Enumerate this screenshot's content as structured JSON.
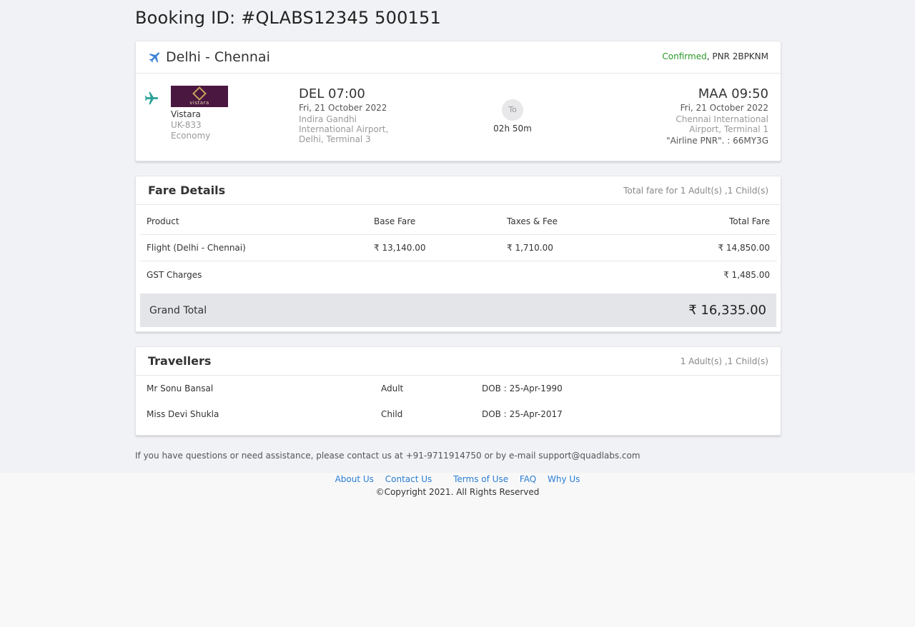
{
  "page": {
    "title": "Booking ID: #QLABS12345 500151"
  },
  "flight": {
    "route": "Delhi - Chennai",
    "status": "Confirmed",
    "pnr_text": ", PNR 2BPKNM",
    "airline": {
      "logo_text": "vistara",
      "name": "Vistara",
      "code": "UK-833",
      "cabin": "Economy"
    },
    "departure": {
      "code_time": "DEL 07:00",
      "date": "Fri, 21 October 2022",
      "airport": "Indira Gandhi International Airport, Delhi, Terminal 3"
    },
    "connector": "To",
    "duration": "02h 50m",
    "arrival": {
      "code_time": "MAA 09:50",
      "date": "Fri, 21 October 2022",
      "airport": "Chennai International Airport, Terminal 1",
      "airline_pnr": "\"Airline PNR\". : 66MY3G"
    },
    "colors": {
      "accent": "#2aa198",
      "status_ok": "#2a9a2a",
      "logo_bg": "#4a1740"
    }
  },
  "fare": {
    "heading": "Fare Details",
    "summary": "Total fare for 1 Adult(s) ,1 Child(s)",
    "columns": [
      "Product",
      "Base Fare",
      "Taxes & Fee",
      "Total Fare"
    ],
    "rows": [
      {
        "product": "Flight (Delhi - Chennai)",
        "base": "₹ 13,140.00",
        "tax": "₹ 1,710.00",
        "total": "₹ 14,850.00"
      },
      {
        "product": "GST Charges",
        "base": "",
        "tax": "",
        "total": "₹ 1,485.00"
      }
    ],
    "grand_label": "Grand Total",
    "grand_amount": "₹ 16,335.00"
  },
  "travellers": {
    "heading": "Travellers",
    "summary": "1 Adult(s) ,1 Child(s)",
    "list": [
      {
        "name": "Mr Sonu Bansal",
        "type": "Adult",
        "dob": "DOB : 25-Apr-1990"
      },
      {
        "name": "Miss Devi Shukla",
        "type": "Child",
        "dob": "DOB : 25-Apr-2017"
      }
    ]
  },
  "help_text": "If you have questions or need assistance, please contact us at +91-9711914750 or by e-mail support@quadlabs.com",
  "footer": {
    "links": [
      "About Us",
      "Contact Us",
      "Terms of Use",
      "FAQ",
      "Why Us"
    ],
    "copyright": "©Copyright 2021. All Rights Reserved"
  }
}
